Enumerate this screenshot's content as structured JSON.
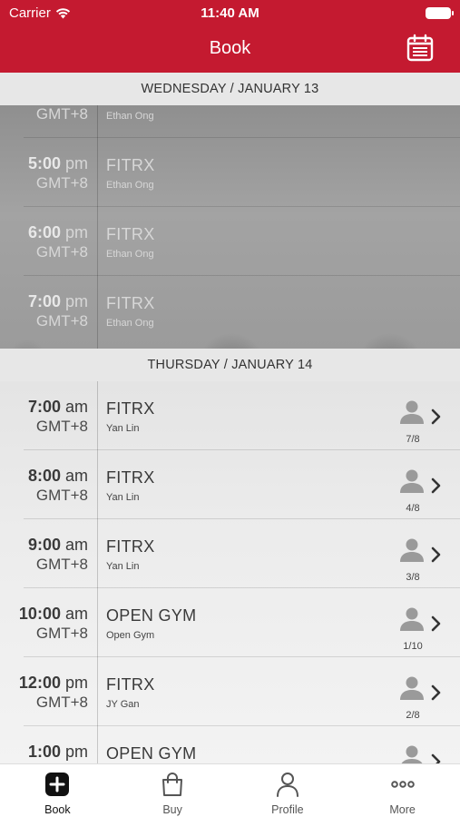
{
  "status_bar": {
    "carrier": "Carrier",
    "time": "11:40 AM"
  },
  "nav": {
    "title": "Book",
    "calendar_icon": "calendar-icon"
  },
  "sections": [
    {
      "header": "WEDNESDAY / JANUARY 13"
    },
    {
      "header": "THURSDAY / JANUARY 14"
    }
  ],
  "past_rows": [
    {
      "time_hm": "",
      "ampm": "",
      "tz": "GMT+8",
      "class_name": "",
      "coach": "Ethan Ong"
    },
    {
      "time_hm": "5:00",
      "ampm": "pm",
      "tz": "GMT+8",
      "class_name": "FITRX",
      "coach": "Ethan Ong"
    },
    {
      "time_hm": "6:00",
      "ampm": "pm",
      "tz": "GMT+8",
      "class_name": "FITRX",
      "coach": "Ethan Ong"
    },
    {
      "time_hm": "7:00",
      "ampm": "pm",
      "tz": "GMT+8",
      "class_name": "FITRX",
      "coach": "Ethan Ong"
    }
  ],
  "rows": [
    {
      "time_hm": "7:00",
      "ampm": "am",
      "tz": "GMT+8",
      "class_name": "FITRX",
      "coach": "Yan Lin",
      "capacity": "7/8"
    },
    {
      "time_hm": "8:00",
      "ampm": "am",
      "tz": "GMT+8",
      "class_name": "FITRX",
      "coach": "Yan Lin",
      "capacity": "4/8"
    },
    {
      "time_hm": "9:00",
      "ampm": "am",
      "tz": "GMT+8",
      "class_name": "FITRX",
      "coach": "Yan Lin",
      "capacity": "3/8"
    },
    {
      "time_hm": "10:00",
      "ampm": "am",
      "tz": "GMT+8",
      "class_name": "OPEN GYM",
      "coach": "Open Gym",
      "capacity": "1/10"
    },
    {
      "time_hm": "12:00",
      "ampm": "pm",
      "tz": "GMT+8",
      "class_name": "FITRX",
      "coach": "JY Gan",
      "capacity": "2/8"
    },
    {
      "time_hm": "1:00",
      "ampm": "pm",
      "tz": "",
      "class_name": "OPEN GYM",
      "coach": "",
      "capacity": ""
    }
  ],
  "tabs": [
    {
      "label": "Book",
      "icon": "plus-square-icon",
      "active": true
    },
    {
      "label": "Buy",
      "icon": "shopping-bag-icon",
      "active": false
    },
    {
      "label": "Profile",
      "icon": "person-icon",
      "active": false
    },
    {
      "label": "More",
      "icon": "more-dots-icon",
      "active": false
    }
  ],
  "colors": {
    "brand": "#c41a30",
    "header_bg": "#e7e7e7",
    "icon_gray": "#9a9a9a"
  }
}
